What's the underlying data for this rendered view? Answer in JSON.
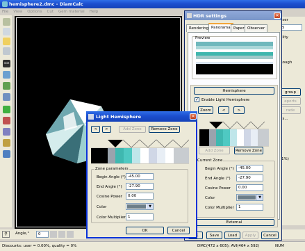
{
  "main": {
    "title": "hemisphere2.dmc - DiamCalc",
    "menu": [
      "File",
      "View",
      "Options",
      "Cut",
      "Gem material",
      "Help"
    ],
    "status": "Discounts: user = 0.00%, quality = 0%",
    "status_right": "DMC(472 x 605); AVI(464 x 592)",
    "num": "NUM",
    "angle_label": "Angle,°",
    "angle_value": "0",
    "right_labels": [
      "aser",
      "5",
      "ality",
      "Rough",
      "group",
      "eports",
      "rade",
      "ls...",
      "1%)"
    ]
  },
  "hdr": {
    "title": "HDR settings",
    "tabs": [
      "Rendering",
      "Panorama",
      "Paper",
      "Observer"
    ],
    "preview_label": "Preview",
    "hemisphere_btn": "Hemisphere",
    "enable_label": "Enable Light Hemisphere",
    "zoom_btn": "Zoom",
    "nav_prev": "<",
    "nav_next": ">",
    "add_zone": "Add Zone",
    "remove_zone": "Remove Zone",
    "current_zone_label": "Current Zone",
    "fields": [
      {
        "label": "Begin Angle (°)",
        "value": "-45.00"
      },
      {
        "label": "End Angle (°)",
        "value": "-27.90"
      },
      {
        "label": "Cosine Power",
        "value": "0.00"
      },
      {
        "label": "Color",
        "value": ""
      },
      {
        "label": "Color Multiplier",
        "value": "1"
      }
    ],
    "external_btn": "External",
    "bottom_buttons": [
      "OK",
      "Save",
      "Load",
      "Apply",
      "Cancel"
    ],
    "color_value": "#6c7d88"
  },
  "lh": {
    "title": "Light Hemisphere",
    "nav_prev": "<",
    "nav_next": ">",
    "add_zone": "Add Zone",
    "remove_zone": "Remove Zone",
    "zone_params_label": "Zone parameters",
    "fields": [
      {
        "label": "Begin Angle (°)",
        "value": "-45.00"
      },
      {
        "label": "End Angle (°)",
        "value": "-27.90"
      },
      {
        "label": "Cosine Power",
        "value": "0.00"
      },
      {
        "label": "Color",
        "value": ""
      },
      {
        "label": "Color Multiplier",
        "value": "1"
      }
    ],
    "ok": "OK",
    "cancel": "Cancel",
    "color_value": "#6c7d88",
    "zone_colors": [
      "#000000",
      "#9aa3ad",
      "#3fb8b0",
      "#4fc9c2",
      "#bfe6ea",
      "#ffffff",
      "#d0d7e6",
      "#e8eef5",
      "#ffffff",
      "#c8ccd0"
    ]
  }
}
